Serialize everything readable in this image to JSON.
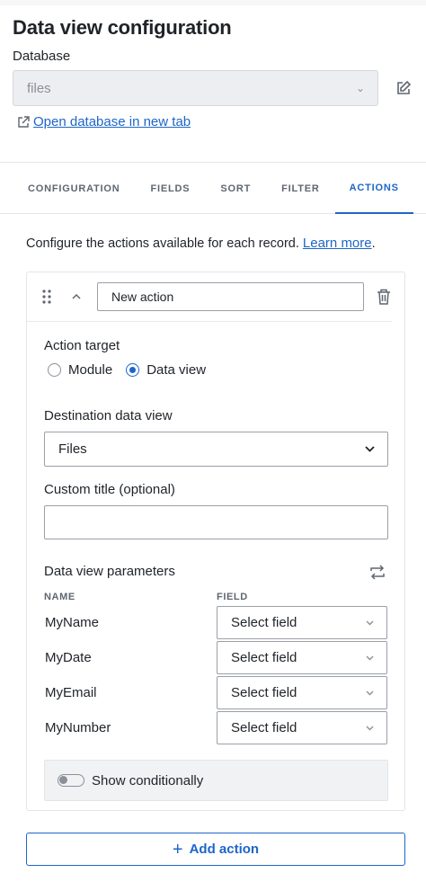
{
  "header": {
    "title": "Data view configuration",
    "database_label": "Database",
    "database_value": "files",
    "open_link": "Open database in new tab"
  },
  "tabs": [
    {
      "label": "CONFIGURATION"
    },
    {
      "label": "FIELDS"
    },
    {
      "label": "SORT"
    },
    {
      "label": "FILTER"
    },
    {
      "label": "ACTIONS"
    }
  ],
  "intro": {
    "text": "Configure the actions available for each record. ",
    "learn_more": "Learn more",
    "period": "."
  },
  "action": {
    "name": "New action",
    "target_label": "Action target",
    "target_options": [
      "Module",
      "Data view"
    ],
    "target_selected": "Data view",
    "destination_label": "Destination data view",
    "destination_value": "Files",
    "custom_title_label": "Custom title (optional)",
    "custom_title_value": "",
    "params_label": "Data view parameters",
    "col_name": "NAME",
    "col_field": "FIELD",
    "params": [
      {
        "name": "MyName",
        "field": "Select field"
      },
      {
        "name": "MyDate",
        "field": "Select field"
      },
      {
        "name": "MyEmail",
        "field": "Select field"
      },
      {
        "name": "MyNumber",
        "field": "Select field"
      }
    ],
    "conditional_label": "Show conditionally"
  },
  "add_action": "Add action",
  "colors": {
    "accent": "#1d66c9",
    "border": "#9aa0a8",
    "muted": "#5f6670"
  }
}
